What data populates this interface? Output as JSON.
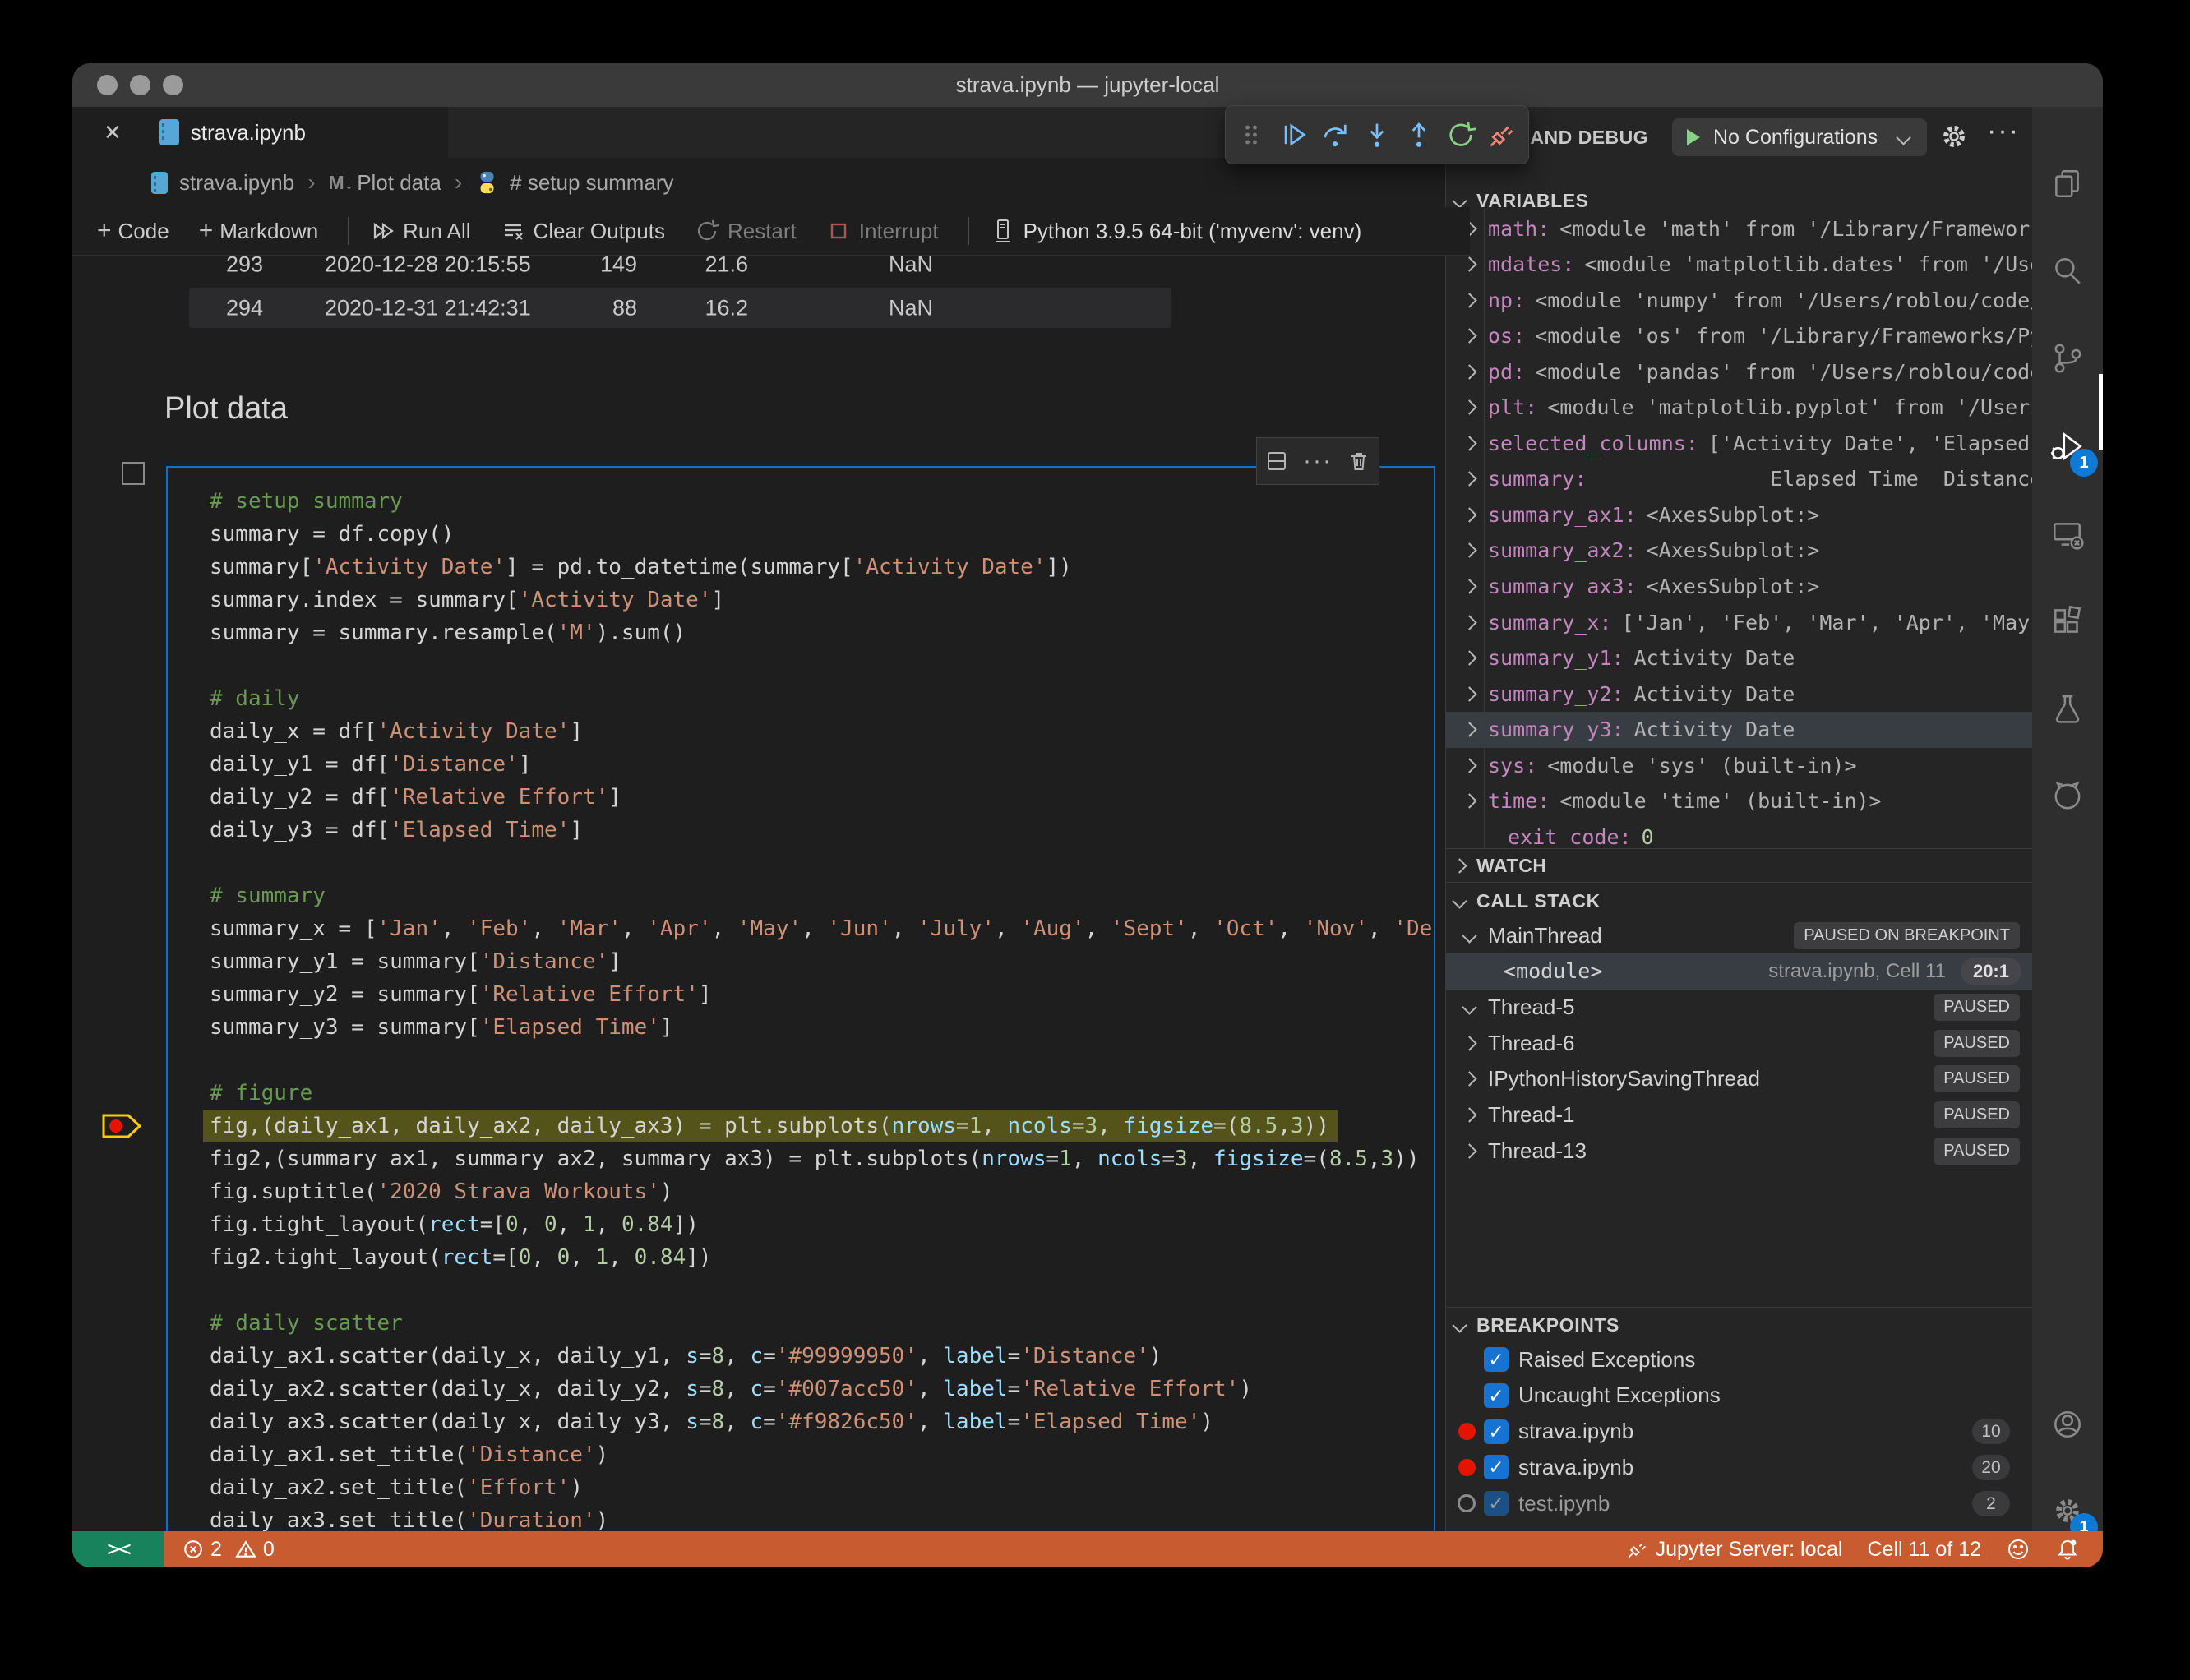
{
  "window": {
    "title": "strava.ipynb — jupyter-local"
  },
  "tab": {
    "label": "strava.ipynb",
    "close_glyph": "✕"
  },
  "breadcrumb": {
    "file": "strava.ipynb",
    "sep": "›",
    "md_icon": "M↓",
    "section": "Plot data",
    "cell": "# setup summary"
  },
  "notebook_toolbar": {
    "code": "Code",
    "markdown": "Markdown",
    "run_all": "Run All",
    "clear_outputs": "Clear Outputs",
    "restart": "Restart",
    "interrupt": "Interrupt",
    "kernel": "Python 3.9.5 64-bit ('myvenv': venv)"
  },
  "output_table": {
    "rows": [
      [
        "293",
        "2020-12-28 20:15:55",
        "149",
        "21.6",
        "NaN"
      ],
      [
        "294",
        "2020-12-31 21:42:31",
        "88",
        "16.2",
        "NaN"
      ]
    ]
  },
  "markdown": {
    "heading": "Plot data"
  },
  "code": {
    "lines": [
      {
        "t": [
          [
            "c",
            "# setup summary"
          ]
        ]
      },
      {
        "t": [
          [
            "p",
            "summary = df.copy()"
          ]
        ]
      },
      {
        "t": [
          [
            "p",
            "summary["
          ],
          [
            "s",
            "'Activity Date'"
          ],
          [
            "p",
            "] = pd.to_datetime(summary["
          ],
          [
            "s",
            "'Activity Date'"
          ],
          [
            "p",
            "])"
          ]
        ]
      },
      {
        "t": [
          [
            "p",
            "summary.index = summary["
          ],
          [
            "s",
            "'Activity Date'"
          ],
          [
            "p",
            "]"
          ]
        ]
      },
      {
        "t": [
          [
            "p",
            "summary = summary.resample("
          ],
          [
            "s",
            "'M'"
          ],
          [
            "p",
            ").sum()"
          ]
        ]
      },
      {
        "t": []
      },
      {
        "t": [
          [
            "c",
            "# daily"
          ]
        ]
      },
      {
        "t": [
          [
            "p",
            "daily_x = df["
          ],
          [
            "s",
            "'Activity Date'"
          ],
          [
            "p",
            "]"
          ]
        ]
      },
      {
        "t": [
          [
            "p",
            "daily_y1 = df["
          ],
          [
            "s",
            "'Distance'"
          ],
          [
            "p",
            "]"
          ]
        ]
      },
      {
        "t": [
          [
            "p",
            "daily_y2 = df["
          ],
          [
            "s",
            "'Relative Effort'"
          ],
          [
            "p",
            "]"
          ]
        ]
      },
      {
        "t": [
          [
            "p",
            "daily_y3 = df["
          ],
          [
            "s",
            "'Elapsed Time'"
          ],
          [
            "p",
            "]"
          ]
        ]
      },
      {
        "t": []
      },
      {
        "t": [
          [
            "c",
            "# summary"
          ]
        ]
      },
      {
        "t": [
          [
            "p",
            "summary_x = ["
          ],
          [
            "s",
            "'Jan'"
          ],
          [
            "p",
            ", "
          ],
          [
            "s",
            "'Feb'"
          ],
          [
            "p",
            ", "
          ],
          [
            "s",
            "'Mar'"
          ],
          [
            "p",
            ", "
          ],
          [
            "s",
            "'Apr'"
          ],
          [
            "p",
            ", "
          ],
          [
            "s",
            "'May'"
          ],
          [
            "p",
            ", "
          ],
          [
            "s",
            "'Jun'"
          ],
          [
            "p",
            ", "
          ],
          [
            "s",
            "'July'"
          ],
          [
            "p",
            ", "
          ],
          [
            "s",
            "'Aug'"
          ],
          [
            "p",
            ", "
          ],
          [
            "s",
            "'Sept'"
          ],
          [
            "p",
            ", "
          ],
          [
            "s",
            "'Oct'"
          ],
          [
            "p",
            ", "
          ],
          [
            "s",
            "'Nov'"
          ],
          [
            "p",
            ", "
          ],
          [
            "s",
            "'Dec'"
          ],
          [
            "p",
            "]"
          ]
        ]
      },
      {
        "t": [
          [
            "p",
            "summary_y1 = summary["
          ],
          [
            "s",
            "'Distance'"
          ],
          [
            "p",
            "]"
          ]
        ]
      },
      {
        "t": [
          [
            "p",
            "summary_y2 = summary["
          ],
          [
            "s",
            "'Relative Effort'"
          ],
          [
            "p",
            "]"
          ]
        ]
      },
      {
        "t": [
          [
            "p",
            "summary_y3 = summary["
          ],
          [
            "s",
            "'Elapsed Time'"
          ],
          [
            "p",
            "]"
          ]
        ]
      },
      {
        "t": []
      },
      {
        "t": [
          [
            "c",
            "# figure"
          ]
        ]
      },
      {
        "hl": true,
        "bp": true,
        "t": [
          [
            "p",
            "fig,(daily_ax1, daily_ax2, daily_ax3) = plt.subplots("
          ],
          [
            "v",
            "nrows"
          ],
          [
            "p",
            "="
          ],
          [
            "n",
            "1"
          ],
          [
            "p",
            ", "
          ],
          [
            "v",
            "ncols"
          ],
          [
            "p",
            "="
          ],
          [
            "n",
            "3"
          ],
          [
            "p",
            ", "
          ],
          [
            "v",
            "figsize"
          ],
          [
            "p",
            "=("
          ],
          [
            "n",
            "8.5"
          ],
          [
            "p",
            ","
          ],
          [
            "n",
            "3"
          ],
          [
            "p",
            "))"
          ]
        ]
      },
      {
        "t": [
          [
            "p",
            "fig2,(summary_ax1, summary_ax2, summary_ax3) = plt.subplots("
          ],
          [
            "v",
            "nrows"
          ],
          [
            "p",
            "="
          ],
          [
            "n",
            "1"
          ],
          [
            "p",
            ", "
          ],
          [
            "v",
            "ncols"
          ],
          [
            "p",
            "="
          ],
          [
            "n",
            "3"
          ],
          [
            "p",
            ", "
          ],
          [
            "v",
            "figsize"
          ],
          [
            "p",
            "=("
          ],
          [
            "n",
            "8.5"
          ],
          [
            "p",
            ","
          ],
          [
            "n",
            "3"
          ],
          [
            "p",
            "))"
          ]
        ]
      },
      {
        "t": [
          [
            "p",
            "fig.suptitle("
          ],
          [
            "s",
            "'2020 Strava Workouts'"
          ],
          [
            "p",
            ")"
          ]
        ]
      },
      {
        "t": [
          [
            "p",
            "fig.tight_layout("
          ],
          [
            "v",
            "rect"
          ],
          [
            "p",
            "=["
          ],
          [
            "n",
            "0"
          ],
          [
            "p",
            ", "
          ],
          [
            "n",
            "0"
          ],
          [
            "p",
            ", "
          ],
          [
            "n",
            "1"
          ],
          [
            "p",
            ", "
          ],
          [
            "n",
            "0.84"
          ],
          [
            "p",
            "])"
          ]
        ]
      },
      {
        "t": [
          [
            "p",
            "fig2.tight_layout("
          ],
          [
            "v",
            "rect"
          ],
          [
            "p",
            "=["
          ],
          [
            "n",
            "0"
          ],
          [
            "p",
            ", "
          ],
          [
            "n",
            "0"
          ],
          [
            "p",
            ", "
          ],
          [
            "n",
            "1"
          ],
          [
            "p",
            ", "
          ],
          [
            "n",
            "0.84"
          ],
          [
            "p",
            "])"
          ]
        ]
      },
      {
        "t": []
      },
      {
        "t": [
          [
            "c",
            "# daily scatter"
          ]
        ]
      },
      {
        "t": [
          [
            "p",
            "daily_ax1.scatter(daily_x, daily_y1, "
          ],
          [
            "v",
            "s"
          ],
          [
            "p",
            "="
          ],
          [
            "n",
            "8"
          ],
          [
            "p",
            ", "
          ],
          [
            "v",
            "c"
          ],
          [
            "p",
            "="
          ],
          [
            "s",
            "'#99999950'"
          ],
          [
            "p",
            ", "
          ],
          [
            "v",
            "label"
          ],
          [
            "p",
            "="
          ],
          [
            "s",
            "'Distance'"
          ],
          [
            "p",
            ")"
          ]
        ]
      },
      {
        "t": [
          [
            "p",
            "daily_ax2.scatter(daily_x, daily_y2, "
          ],
          [
            "v",
            "s"
          ],
          [
            "p",
            "="
          ],
          [
            "n",
            "8"
          ],
          [
            "p",
            ", "
          ],
          [
            "v",
            "c"
          ],
          [
            "p",
            "="
          ],
          [
            "s",
            "'#007acc50'"
          ],
          [
            "p",
            ", "
          ],
          [
            "v",
            "label"
          ],
          [
            "p",
            "="
          ],
          [
            "s",
            "'Relative Effort'"
          ],
          [
            "p",
            ")"
          ]
        ]
      },
      {
        "t": [
          [
            "p",
            "daily_ax3.scatter(daily_x, daily_y3, "
          ],
          [
            "v",
            "s"
          ],
          [
            "p",
            "="
          ],
          [
            "n",
            "8"
          ],
          [
            "p",
            ", "
          ],
          [
            "v",
            "c"
          ],
          [
            "p",
            "="
          ],
          [
            "s",
            "'#f9826c50'"
          ],
          [
            "p",
            ", "
          ],
          [
            "v",
            "label"
          ],
          [
            "p",
            "="
          ],
          [
            "s",
            "'Elapsed Time'"
          ],
          [
            "p",
            ")"
          ]
        ]
      },
      {
        "t": [
          [
            "p",
            "daily_ax1.set_title("
          ],
          [
            "s",
            "'Distance'"
          ],
          [
            "p",
            ")"
          ]
        ]
      },
      {
        "t": [
          [
            "p",
            "daily_ax2.set_title("
          ],
          [
            "s",
            "'Effort'"
          ],
          [
            "p",
            ")"
          ]
        ]
      },
      {
        "t": [
          [
            "p",
            "daily_ax3.set_title("
          ],
          [
            "s",
            "'Duration'"
          ],
          [
            "p",
            ")"
          ]
        ]
      }
    ]
  },
  "panel": {
    "title": "RUN AND DEBUG",
    "config_button": {
      "label": "No Configurations"
    },
    "variables": {
      "label": "VARIABLES",
      "items": [
        {
          "name": "math",
          "value": "<module 'math' from '/Library/Frameworks…"
        },
        {
          "name": "mdates",
          "value": "<module 'matplotlib.dates' from '/User…"
        },
        {
          "name": "np",
          "value": "<module 'numpy' from '/Users/roblou/code/j…"
        },
        {
          "name": "os",
          "value": "<module 'os' from '/Library/Frameworks/Pyt…"
        },
        {
          "name": "pd",
          "value": "<module 'pandas' from '/Users/roblou/code/…"
        },
        {
          "name": "plt",
          "value": "<module 'matplotlib.pyplot' from '/Users/…"
        },
        {
          "name": "selected_columns",
          "value": "['Activity Date', 'Elapsed T…"
        },
        {
          "name": "summary",
          "value": "              Elapsed Time  Distance…"
        },
        {
          "name": "summary_ax1",
          "value": "<AxesSubplot:>"
        },
        {
          "name": "summary_ax2",
          "value": "<AxesSubplot:>"
        },
        {
          "name": "summary_ax3",
          "value": "<AxesSubplot:>"
        },
        {
          "name": "summary_x",
          "value": "['Jan', 'Feb', 'Mar', 'Apr', 'May',…"
        },
        {
          "name": "summary_y1",
          "value": "Activity Date"
        },
        {
          "name": "summary_y2",
          "value": "Activity Date"
        },
        {
          "name": "summary_y3",
          "value": "Activity Date",
          "selected": true
        },
        {
          "name": "sys",
          "value": "<module 'sys' (built-in)>"
        },
        {
          "name": "time",
          "value": "<module 'time' (built-in)>"
        },
        {
          "name": "_exit_code",
          "value": "0",
          "green": true,
          "nochevron": true
        }
      ]
    },
    "watch": {
      "label": "WATCH"
    },
    "call_stack": {
      "label": "CALL STACK",
      "items": [
        {
          "label": "MainThread",
          "badge": "PAUSED ON BREAKPOINT",
          "expanded": true
        },
        {
          "label": "<module>",
          "frame": true,
          "location": "strava.ipynb, Cell 11",
          "line_badge": "20:1",
          "selected": true
        },
        {
          "label": "Thread-5",
          "badge": "PAUSED",
          "expanded": true
        },
        {
          "label": "Thread-6",
          "badge": "PAUSED"
        },
        {
          "label": "IPythonHistorySavingThread",
          "badge": "PAUSED"
        },
        {
          "label": "Thread-1",
          "badge": "PAUSED"
        },
        {
          "label": "Thread-13",
          "badge": "PAUSED"
        }
      ]
    },
    "breakpoints": {
      "label": "BREAKPOINTS",
      "items": [
        {
          "label": "Raised Exceptions",
          "checked": true
        },
        {
          "label": "Uncaught Exceptions",
          "checked": true
        },
        {
          "label": "strava.ipynb",
          "checked": true,
          "dot": "red",
          "line": "10"
        },
        {
          "label": "strava.ipynb",
          "checked": true,
          "dot": "red",
          "line": "20"
        },
        {
          "label": "test.ipynb",
          "checked": true,
          "dot": "gray",
          "line": "2",
          "dimmed": true
        }
      ]
    }
  },
  "debug_toolbar": {
    "buttons": [
      "drag-handle",
      "continue",
      "step-over",
      "step-into",
      "step-out",
      "restart",
      "disconnect"
    ]
  },
  "activity_bar": {
    "items": [
      {
        "name": "explorer"
      },
      {
        "name": "search"
      },
      {
        "name": "source-control"
      },
      {
        "name": "run-debug",
        "active": true,
        "badge": "1"
      },
      {
        "name": "remote-explorer"
      },
      {
        "name": "extensions"
      },
      {
        "name": "testing"
      },
      {
        "name": "github"
      },
      {
        "name": "account"
      },
      {
        "name": "settings",
        "badge": "1"
      }
    ]
  },
  "statusbar": {
    "errors": "2",
    "warnings": "0",
    "jupyter": "Jupyter Server: local",
    "cell_indicator": "Cell 11 of 12"
  }
}
